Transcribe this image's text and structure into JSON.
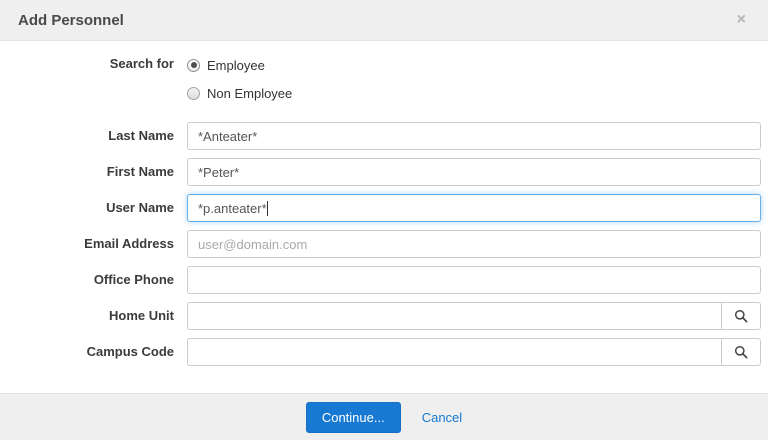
{
  "modal": {
    "title": "Add Personnel",
    "close_icon": "close-x"
  },
  "form": {
    "search_for": {
      "label": "Search for",
      "options": [
        {
          "label": "Employee",
          "selected": true
        },
        {
          "label": "Non Employee",
          "selected": false
        }
      ]
    },
    "fields": [
      {
        "label": "Last Name",
        "value": "*Anteater*",
        "placeholder": "",
        "focused": false,
        "has_search": false
      },
      {
        "label": "First Name",
        "value": "*Peter*",
        "placeholder": "",
        "focused": false,
        "has_search": false
      },
      {
        "label": "User Name",
        "value": "*p.anteater*",
        "placeholder": "",
        "focused": true,
        "has_search": false
      },
      {
        "label": "Email Address",
        "value": "",
        "placeholder": "user@domain.com",
        "focused": false,
        "has_search": false
      },
      {
        "label": "Office Phone",
        "value": "",
        "placeholder": "",
        "focused": false,
        "has_search": false
      },
      {
        "label": "Home Unit",
        "value": "",
        "placeholder": "",
        "focused": false,
        "has_search": true
      },
      {
        "label": "Campus Code",
        "value": "",
        "placeholder": "",
        "focused": false,
        "has_search": true
      }
    ]
  },
  "footer": {
    "continue_label": "Continue...",
    "cancel_label": "Cancel"
  },
  "icons": {
    "close": "×",
    "search": "magnifier"
  },
  "colors": {
    "accent_blue": "#1779d2",
    "focus_border": "#66afe9",
    "header_bg": "#efefef",
    "input_border": "#cccccc"
  }
}
